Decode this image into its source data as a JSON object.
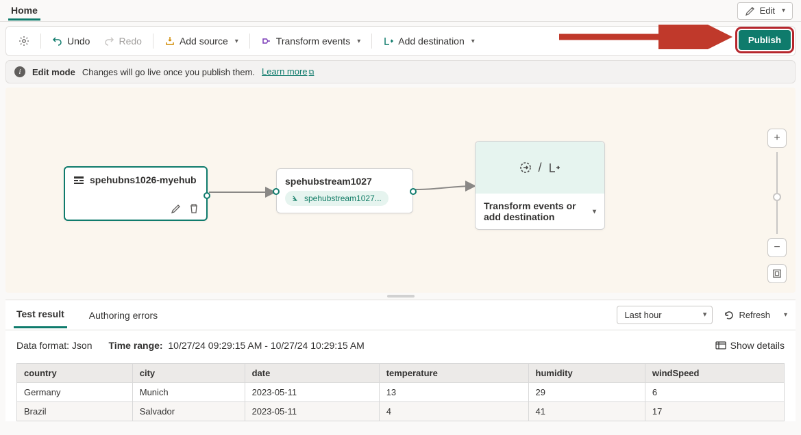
{
  "tabs": {
    "home": "Home"
  },
  "edit_btn": "Edit",
  "toolbar": {
    "undo": "Undo",
    "redo": "Redo",
    "add_source": "Add source",
    "transform": "Transform events",
    "add_dest": "Add destination",
    "publish": "Publish"
  },
  "infobar": {
    "title": "Edit mode",
    "msg": "Changes will go live once you publish them.",
    "link": "Learn more"
  },
  "nodes": {
    "source": {
      "title": "spehubns1026-myehub"
    },
    "stream": {
      "title": "spehubstream1027",
      "pill": "spehubstream1027..."
    },
    "placeholder": {
      "text": "Transform events or add destination"
    }
  },
  "results": {
    "tabs": {
      "test": "Test result",
      "errors": "Authoring errors"
    },
    "range_select": "Last hour",
    "refresh": "Refresh",
    "format_label": "Data format:",
    "format_value": "Json",
    "range_label": "Time range:",
    "range_value": "10/27/24 09:29:15 AM - 10/27/24 10:29:15 AM",
    "details": "Show details",
    "columns": [
      "country",
      "city",
      "date",
      "temperature",
      "humidity",
      "windSpeed"
    ],
    "rows": [
      [
        "Germany",
        "Munich",
        "2023-05-11",
        "13",
        "29",
        "6"
      ],
      [
        "Brazil",
        "Salvador",
        "2023-05-11",
        "4",
        "41",
        "17"
      ]
    ]
  },
  "chart_data": {
    "type": "table",
    "columns": [
      "country",
      "city",
      "date",
      "temperature",
      "humidity",
      "windSpeed"
    ],
    "rows": [
      [
        "Germany",
        "Munich",
        "2023-05-11",
        13,
        29,
        6
      ],
      [
        "Brazil",
        "Salvador",
        "2023-05-11",
        4,
        41,
        17
      ]
    ]
  }
}
